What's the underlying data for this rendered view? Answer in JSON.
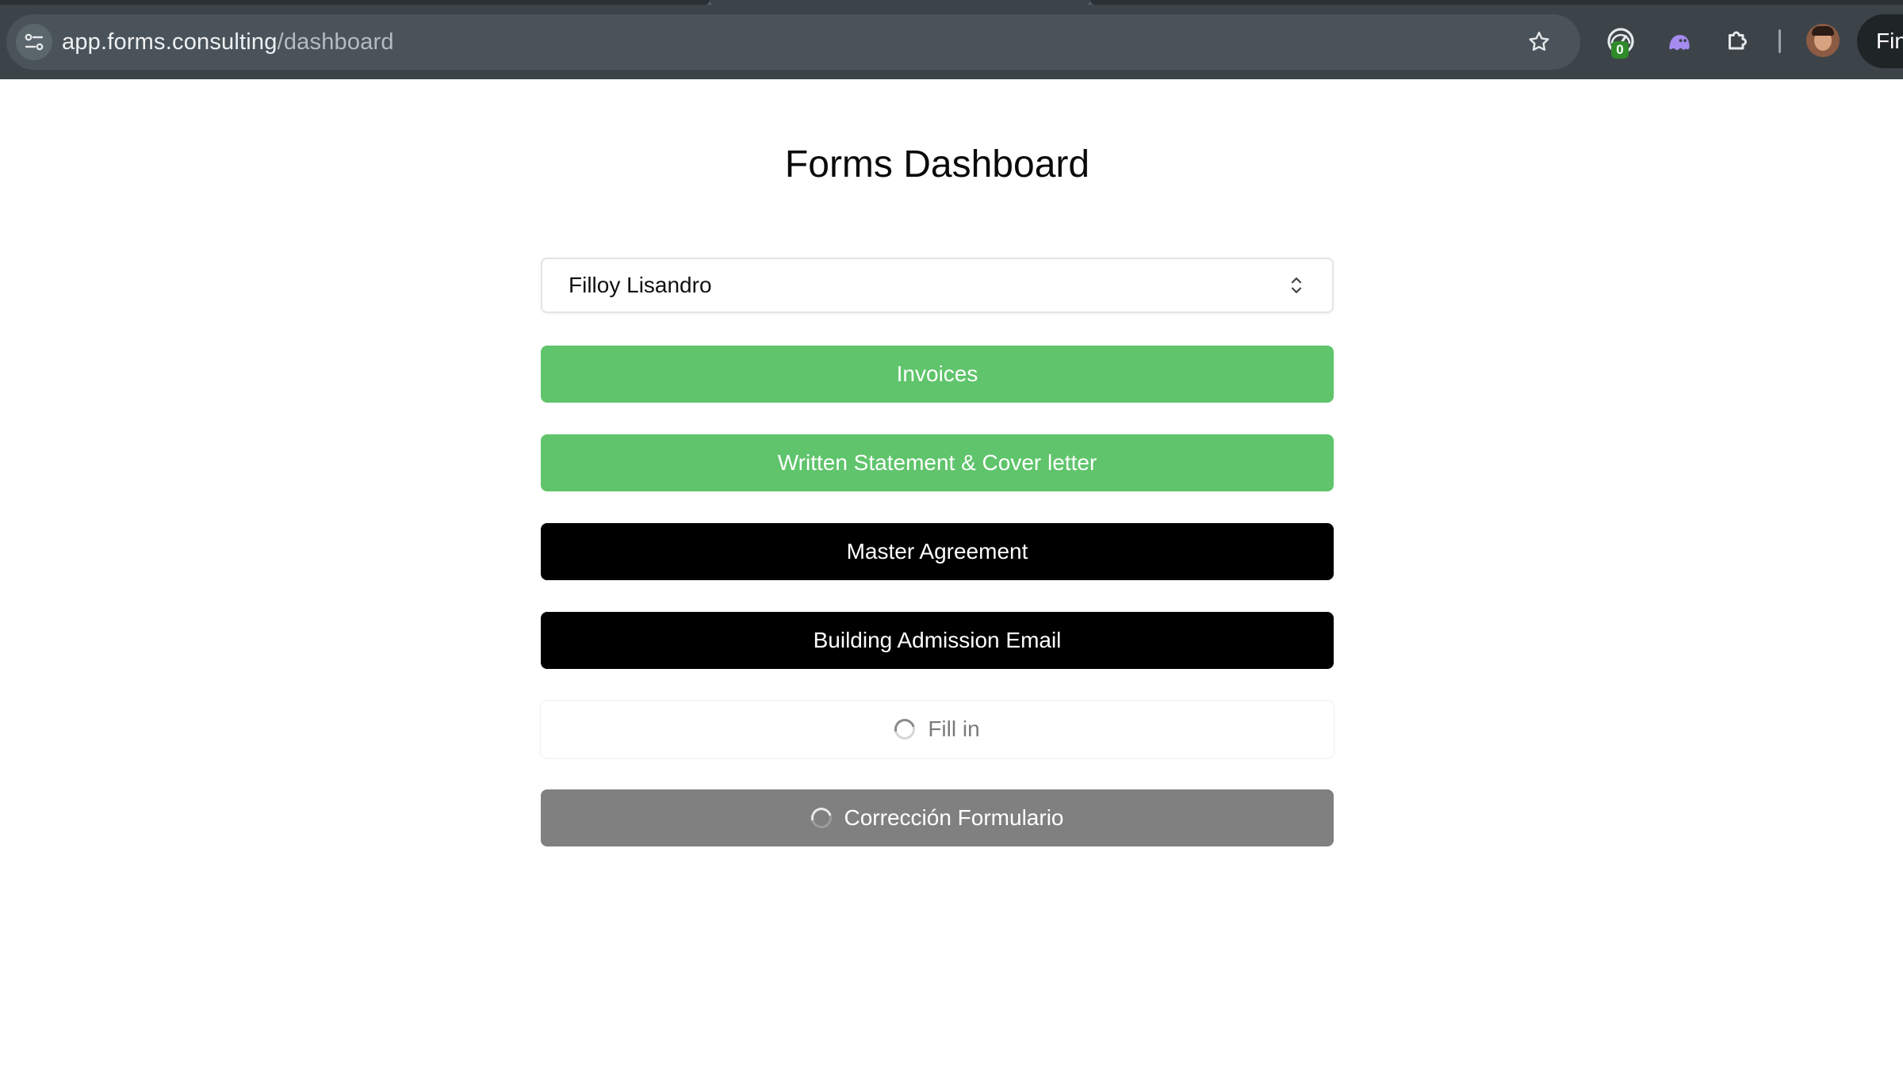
{
  "browser": {
    "url_host": "app.forms.consulting",
    "url_path": "/dashboard",
    "extension_badge_count": "0",
    "profile_button_label": "Fin"
  },
  "page": {
    "title": "Forms Dashboard"
  },
  "client_select": {
    "selected_value": "Filloy Lisandro"
  },
  "actions": [
    {
      "label": "Invoices",
      "style": "green",
      "color": "#5fc46b",
      "loading": false
    },
    {
      "label": "Written Statement & Cover letter",
      "style": "green",
      "color": "#5fc46b",
      "loading": false
    },
    {
      "label": "Master Agreement",
      "style": "black",
      "color": "#000000",
      "loading": false
    },
    {
      "label": "Building Admission Email",
      "style": "black",
      "color": "#000000",
      "loading": false
    },
    {
      "label": "Fill in",
      "style": "white",
      "color": "#ffffff",
      "loading": true
    },
    {
      "label": "Corrección Formulario",
      "style": "gray",
      "color": "#808080",
      "loading": true
    }
  ],
  "icons": {
    "site_info": "tune-icon",
    "bookmark": "star-icon",
    "extension_1": "speedometer-icon",
    "extension_2": "ghost-icon",
    "extensions_menu": "puzzle-icon",
    "select_chevron": "chevron-up-down-icon",
    "loading": "spinner-icon"
  }
}
